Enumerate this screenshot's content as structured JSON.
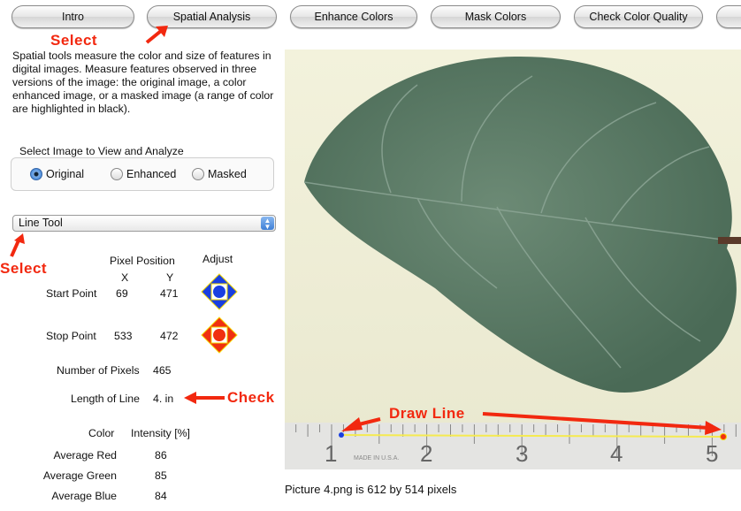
{
  "tabs": [
    {
      "label": "Intro"
    },
    {
      "label": "Spatial Analysis"
    },
    {
      "label": "Enhance Colors"
    },
    {
      "label": "Mask Colors"
    },
    {
      "label": "Check Color Quality"
    }
  ],
  "annotations": {
    "select1": "Select",
    "select2": "Select",
    "check": "Check",
    "draw_line": "Draw Line",
    "color": "#f2280f"
  },
  "description": "Spatial tools measure the color and size of features in digital images.  Measure features observed in three versions of the image: the original image, a color enhanced image, or a masked image (a range of color are highlighted in black).",
  "image_select": {
    "label": "Select Image to View and Analyze",
    "options": [
      {
        "label": "Original",
        "selected": true
      },
      {
        "label": "Enhanced",
        "selected": false
      },
      {
        "label": "Masked",
        "selected": false
      }
    ]
  },
  "tool_select": {
    "value": "Line Tool"
  },
  "measure": {
    "pixel_position_label": "Pixel Position",
    "x_label": "X",
    "y_label": "Y",
    "adjust_label": "Adjust",
    "start": {
      "label": "Start Point",
      "x": "69",
      "y": "471",
      "color": "#1a3fe0"
    },
    "stop": {
      "label": "Stop Point",
      "x": "533",
      "y": "472",
      "color": "#f03010"
    },
    "num_pixels_label": "Number of Pixels",
    "num_pixels": "465",
    "length_label": "Length of Line",
    "length": "4. in"
  },
  "color": {
    "color_label": "Color",
    "intensity_label": "Intensity [%]",
    "rows": [
      {
        "label": "Average Red",
        "value": "86"
      },
      {
        "label": "Average Green",
        "value": "85"
      },
      {
        "label": "Average Blue",
        "value": "84"
      }
    ]
  },
  "image": {
    "caption": "Picture 4.png is 612 by 514 pixels",
    "ruler_numbers": [
      "1",
      "2",
      "3",
      "4",
      "5"
    ],
    "ruler_text": "MADE IN U.S.A."
  }
}
